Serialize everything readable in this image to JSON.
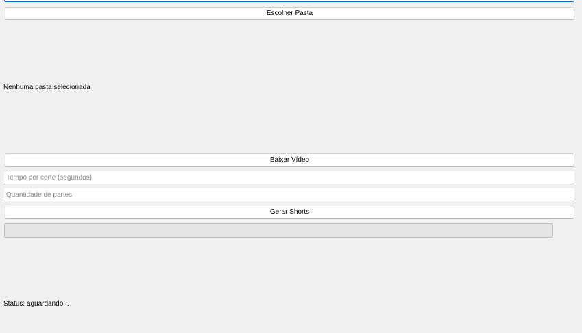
{
  "folder": {
    "choose_button_label": "Escolher Pasta",
    "selected_status": "Nenhuma pasta selecionada"
  },
  "download": {
    "button_label": "Baixar Vídeo"
  },
  "inputs": {
    "cut_time_placeholder": "Tempo por corte (segundos)",
    "cut_time_value": "",
    "parts_placeholder": "Quantidade de partes",
    "parts_value": ""
  },
  "generate": {
    "button_label": "Gerar Shorts"
  },
  "progress": {
    "value_percent": 0
  },
  "status": {
    "text": "Status: aguardando..."
  }
}
